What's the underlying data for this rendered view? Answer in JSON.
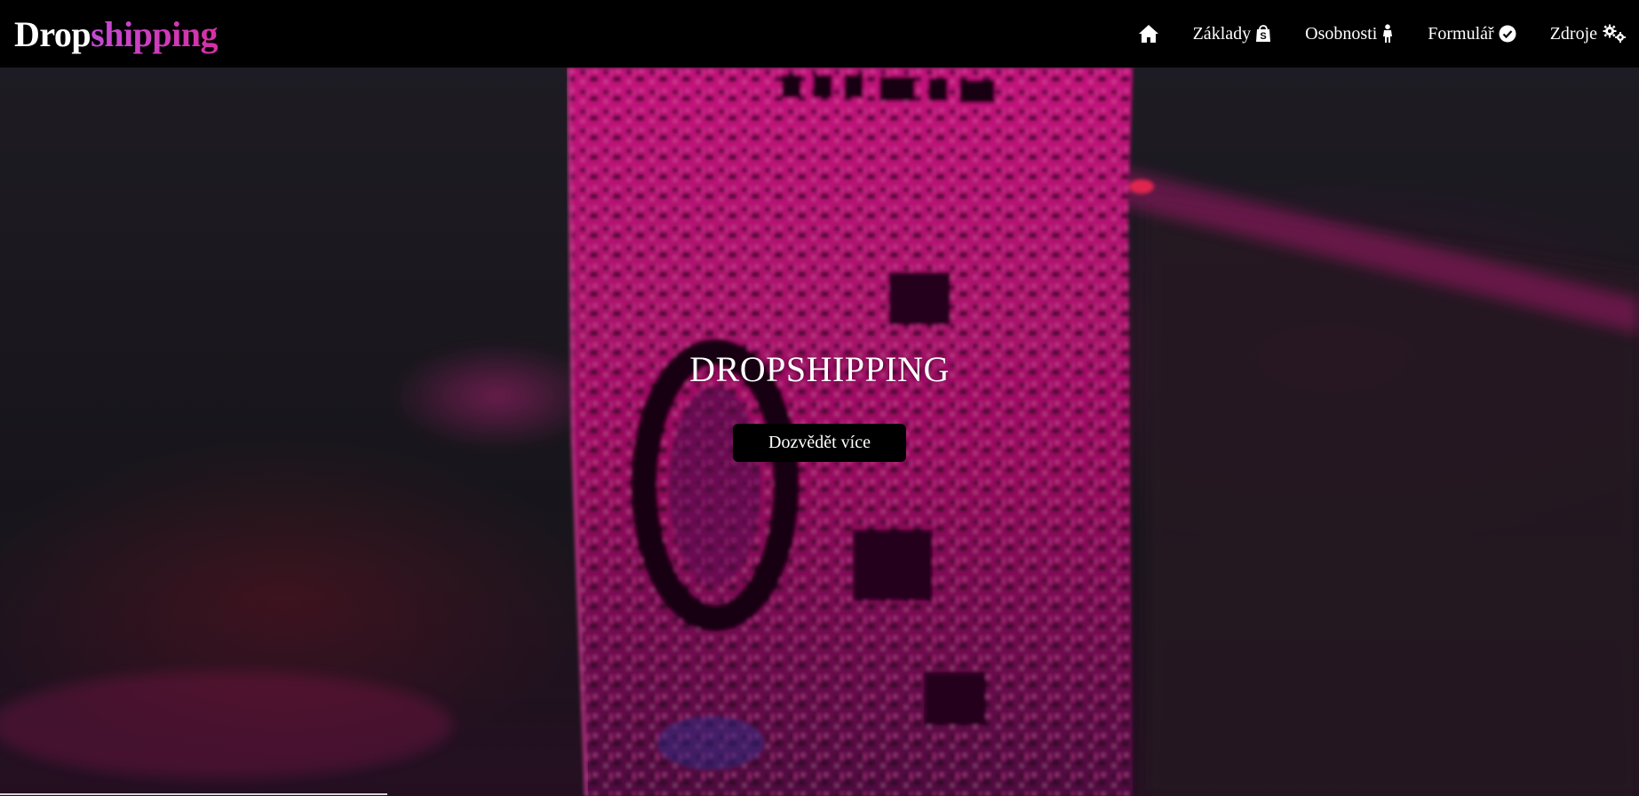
{
  "navbar": {
    "brand": {
      "part1": "Drop",
      "part2": "shipping"
    },
    "items": [
      {
        "label": "",
        "icon": "home-icon"
      },
      {
        "label": "Základy",
        "icon": "shopify-bag-icon"
      },
      {
        "label": "Osobnosti",
        "icon": "person-icon"
      },
      {
        "label": "Formulář",
        "icon": "check-circle-icon"
      },
      {
        "label": "Zdroje",
        "icon": "cogs-icon"
      }
    ]
  },
  "hero": {
    "title": "DROPSHIPPING",
    "button_label": "Dozvědět více",
    "background": "circuit-board-photo-magenta"
  },
  "colors": {
    "navbar_bg": "#000000",
    "brand_white": "#ffffff",
    "brand_gradient_start": "#c44bd6",
    "brand_gradient_end": "#d62fa5",
    "accent_magenta": "#ff1493"
  }
}
